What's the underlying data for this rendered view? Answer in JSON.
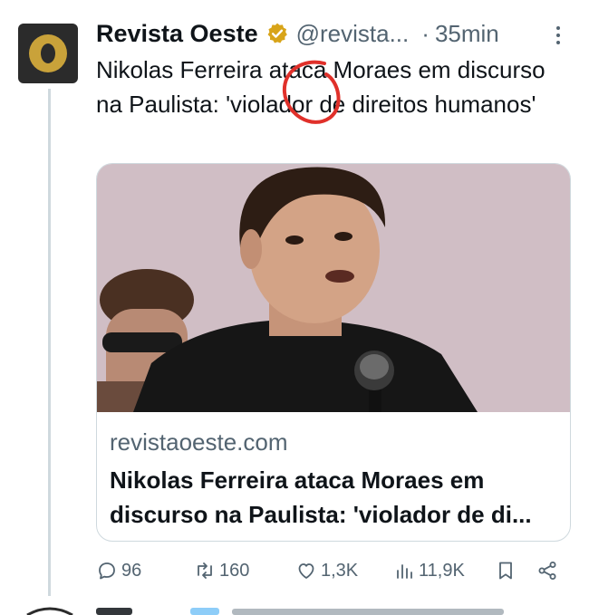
{
  "tweet": {
    "author_name": "Revista Oeste",
    "handle": "@revista...",
    "separator": "·",
    "time": "35min",
    "text": "Nikolas Ferreira ataca Moraes em discurso na Paulista: 'violador de direitos humanos'"
  },
  "card": {
    "domain": "revistaoeste.com",
    "title_line1": "Nikolas Ferreira ataca Moraes em",
    "title_line2": "discurso na Paulista: 'violador de di..."
  },
  "actions": {
    "replies": "96",
    "retweets": "160",
    "likes": "1,3K",
    "views": "11,9K"
  },
  "icons": {
    "verified": "verified-badge-icon",
    "more": "more-vertical-icon",
    "reply": "reply-icon",
    "retweet": "retweet-icon",
    "like": "heart-icon",
    "views": "views-icon",
    "bookmark": "bookmark-icon",
    "share": "share-icon"
  },
  "colors": {
    "verified_gold": "#d8a419",
    "secondary_text": "#536471",
    "annotation_red": "#e0302a",
    "avatar_gold": "#c9a23a"
  }
}
